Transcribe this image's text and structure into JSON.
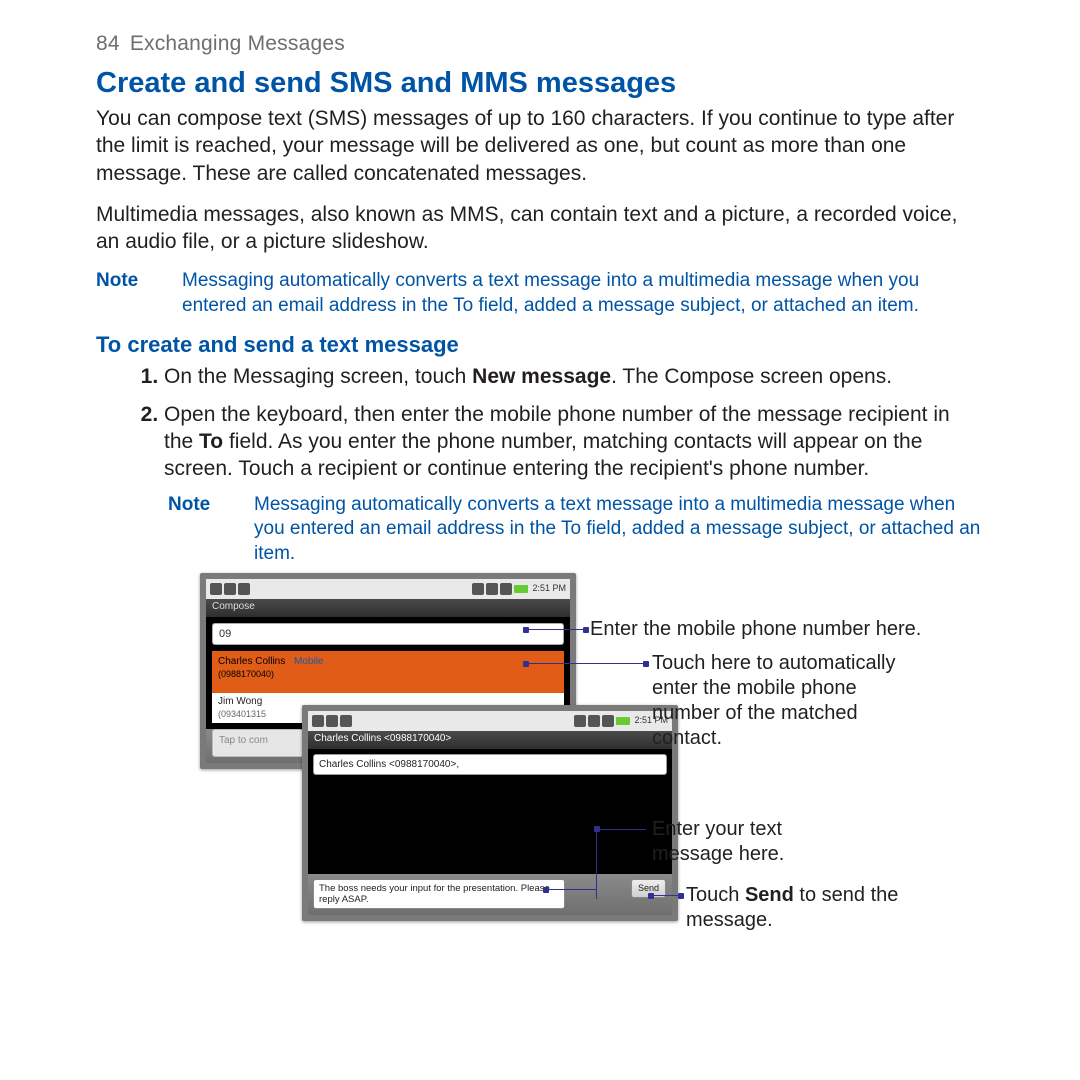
{
  "header": {
    "page_number": "84",
    "chapter_title": "Exchanging Messages"
  },
  "main": {
    "heading": "Create and send SMS and MMS messages",
    "para1": "You can compose text (SMS) messages of up to 160 characters. If you continue to type after the limit is reached, your message will be delivered as one, but count as more than one message. These are called concatenated messages.",
    "para2": "Multimedia messages, also known as MMS, can contain text and a picture, a recorded voice, an audio file, or a picture slideshow.",
    "note1_label": "Note",
    "note1_text": "Messaging automatically converts a text message into a multimedia message when you entered an email address in the To field, added a message subject, or attached an item.",
    "subheading": "To create and send a text message",
    "step1_pre": "On the Messaging screen, touch ",
    "step1_bold": "New message",
    "step1_post": ". The Compose screen opens.",
    "step2_a": "Open the keyboard, then enter the mobile phone number of the message recipient in the ",
    "step2_b_bold": "To",
    "step2_c": " field. As you enter the phone number, matching contacts will appear on the screen. Touch a recipient or continue entering the recipient's phone number.",
    "note2_label": "Note",
    "note2_text": "Messaging automatically converts a text message into a multimedia message when you entered an email address in the To field, added a message subject, or attached an item."
  },
  "figure": {
    "phone1": {
      "clock": "2:51 PM",
      "title": "Compose",
      "to_value": "09",
      "match_name": "Charles Collins",
      "match_type": "Mobile",
      "match_number": "(0988170040)",
      "row2_name": "Jim Wong",
      "row2_number": "(093401315",
      "tap_text": "Tap to com"
    },
    "phone2": {
      "clock": "2:51 PM",
      "title": "Charles Collins <0988170040>",
      "to_display": "Charles Collins <0988170040>,",
      "message_text": "The boss needs your input for the presentation. Please reply ASAP.",
      "send_label": "Send"
    },
    "callouts": {
      "c1": "Enter the mobile phone number here.",
      "c2": "Touch here to automatically enter the mobile phone number of the matched contact.",
      "c3": "Enter your text message here.",
      "c4_pre": "Touch ",
      "c4_bold": "Send",
      "c4_post": " to send the message."
    }
  }
}
